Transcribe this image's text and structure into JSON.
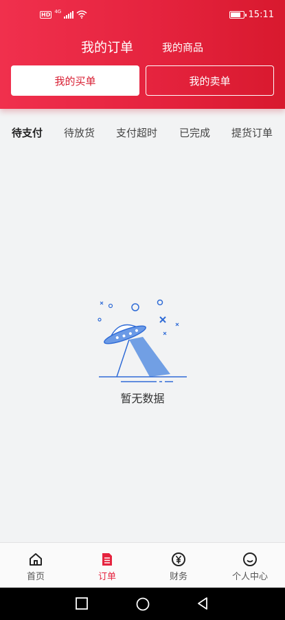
{
  "status_bar": {
    "hd_label": "HD",
    "network": "4G",
    "time": "15:11",
    "battery_level": 0.8,
    "icons": [
      "hd-icon",
      "signal-icon",
      "wifi-icon",
      "battery-icon"
    ]
  },
  "header": {
    "tabs": [
      {
        "label": "我的订单",
        "active": true
      },
      {
        "label": "我的商品",
        "active": false
      }
    ],
    "segments": [
      {
        "label": "我的买单",
        "active": true
      },
      {
        "label": "我的卖单",
        "active": false
      }
    ],
    "colors": {
      "accent": "#e5233e",
      "accent_dark": "#d8192e",
      "accent_light": "#f0304d"
    }
  },
  "order_status_tabs": [
    {
      "label": "待支付",
      "active": true
    },
    {
      "label": "待放货",
      "active": false
    },
    {
      "label": "支付超时",
      "active": false
    },
    {
      "label": "已完成",
      "active": false
    },
    {
      "label": "提货订单",
      "active": false
    }
  ],
  "empty_state": {
    "icon": "ufo-icon",
    "text": "暂无数据"
  },
  "bottom_nav": [
    {
      "label": "首页",
      "icon": "home-icon",
      "active": false
    },
    {
      "label": "订单",
      "icon": "order-icon",
      "active": true
    },
    {
      "label": "财务",
      "icon": "finance-icon",
      "active": false
    },
    {
      "label": "个人中心",
      "icon": "profile-icon",
      "active": false
    }
  ],
  "system_nav": {
    "icons": [
      "recent-apps-icon",
      "home-circle-icon",
      "back-icon"
    ]
  }
}
